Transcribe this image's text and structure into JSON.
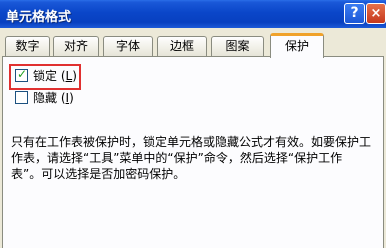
{
  "window": {
    "title": "单元格格式"
  },
  "titlebar": {
    "help_glyph": "?",
    "close_glyph": "×"
  },
  "tabs": [
    {
      "label": "数字"
    },
    {
      "label": "对齐"
    },
    {
      "label": "字体"
    },
    {
      "label": "边框"
    },
    {
      "label": "图案"
    },
    {
      "label": "保护"
    }
  ],
  "active_tab": "保护",
  "options": {
    "locked": {
      "label": "锁定",
      "accel": "L",
      "checked": true
    },
    "hidden": {
      "label": "隐藏",
      "accel": "I",
      "checked": false
    }
  },
  "note": {
    "line1": "只有在工作表被保护时，锁定单元格或隐藏公式才有效。如要保护工",
    "line2": "作表，请选择“工具”菜单中的“保护”命令，然后选择“保护工作",
    "line3": "表”。可以选择是否加密码保护。"
  },
  "colors": {
    "titlebar": "#0a46c9",
    "active_tab_accent": "#f0a22a",
    "highlight_box": "#e03030",
    "check_mark": "#21a121"
  }
}
